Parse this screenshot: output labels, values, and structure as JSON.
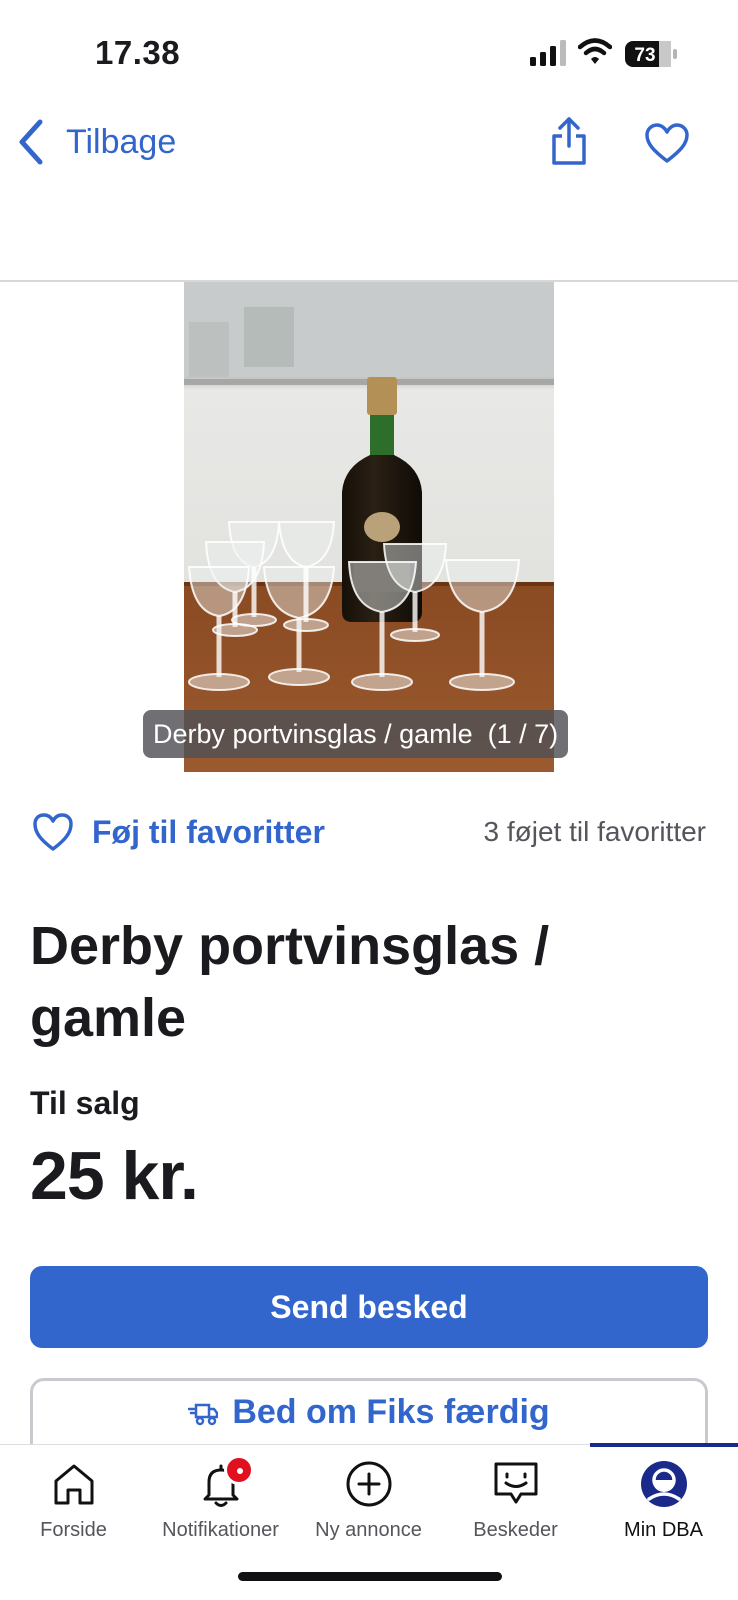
{
  "status_bar": {
    "time": "17.38",
    "battery_level": "73"
  },
  "nav": {
    "back_label": "Tilbage"
  },
  "gallery": {
    "caption": "Derby portvinsglas / gamle  (1 / 7)"
  },
  "favorites": {
    "action_label": "Føj til favoritter",
    "count_text": "3 føjet til favoritter"
  },
  "listing": {
    "title": "Derby portvinsglas / gamle",
    "sale_type": "Til salg",
    "price": "25 kr."
  },
  "actions": {
    "send_label": "Send besked",
    "fiks_label": "Bed om Fiks færdig"
  },
  "tab_bar": {
    "items": [
      {
        "label": "Forside",
        "icon": "home-icon"
      },
      {
        "label": "Notifikationer",
        "icon": "bell-icon"
      },
      {
        "label": "Ny annonce",
        "icon": "plus-circle-icon"
      },
      {
        "label": "Beskeder",
        "icon": "chat-icon"
      },
      {
        "label": "Min DBA",
        "icon": "profile-icon"
      }
    ],
    "active_index": 4
  },
  "colors": {
    "accent": "#3366cc",
    "badge": "#e0101e",
    "active_tab_indicator": "#1a2a8a"
  }
}
